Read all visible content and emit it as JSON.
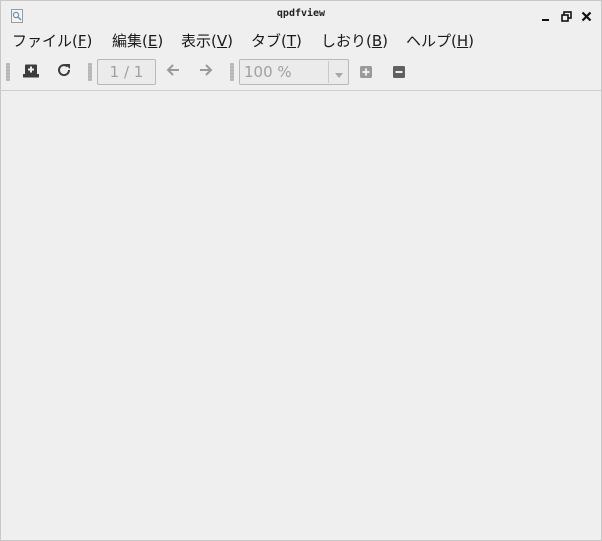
{
  "window": {
    "title": "qpdfview"
  },
  "menubar": {
    "items": [
      {
        "label": "ファイル(F)",
        "pre": "ファイル(",
        "key": "F",
        "post": ")"
      },
      {
        "label": "編集(E)",
        "pre": "編集(",
        "key": "E",
        "post": ")"
      },
      {
        "label": "表示(V)",
        "pre": "表示(",
        "key": "V",
        "post": ")"
      },
      {
        "label": "タブ(T)",
        "pre": "タブ(",
        "key": "T",
        "post": ")"
      },
      {
        "label": "しおり(B)",
        "pre": "しおり(",
        "key": "B",
        "post": ")"
      },
      {
        "label": "ヘルプ(H)",
        "pre": "ヘルプ(",
        "key": "H",
        "post": ")"
      }
    ]
  },
  "toolbar": {
    "page_value": "1 / 1",
    "zoom_value": "100 %",
    "icons": [
      "open-icon",
      "refresh-icon",
      "previous-page-icon",
      "next-page-icon",
      "zoom-in-icon",
      "zoom-out-icon"
    ]
  },
  "colors": {
    "background": "#efefef",
    "icon_dark": "#3c3c3c",
    "icon_disabled": "#9a9a9a",
    "text_disabled": "#a0a0a0"
  }
}
